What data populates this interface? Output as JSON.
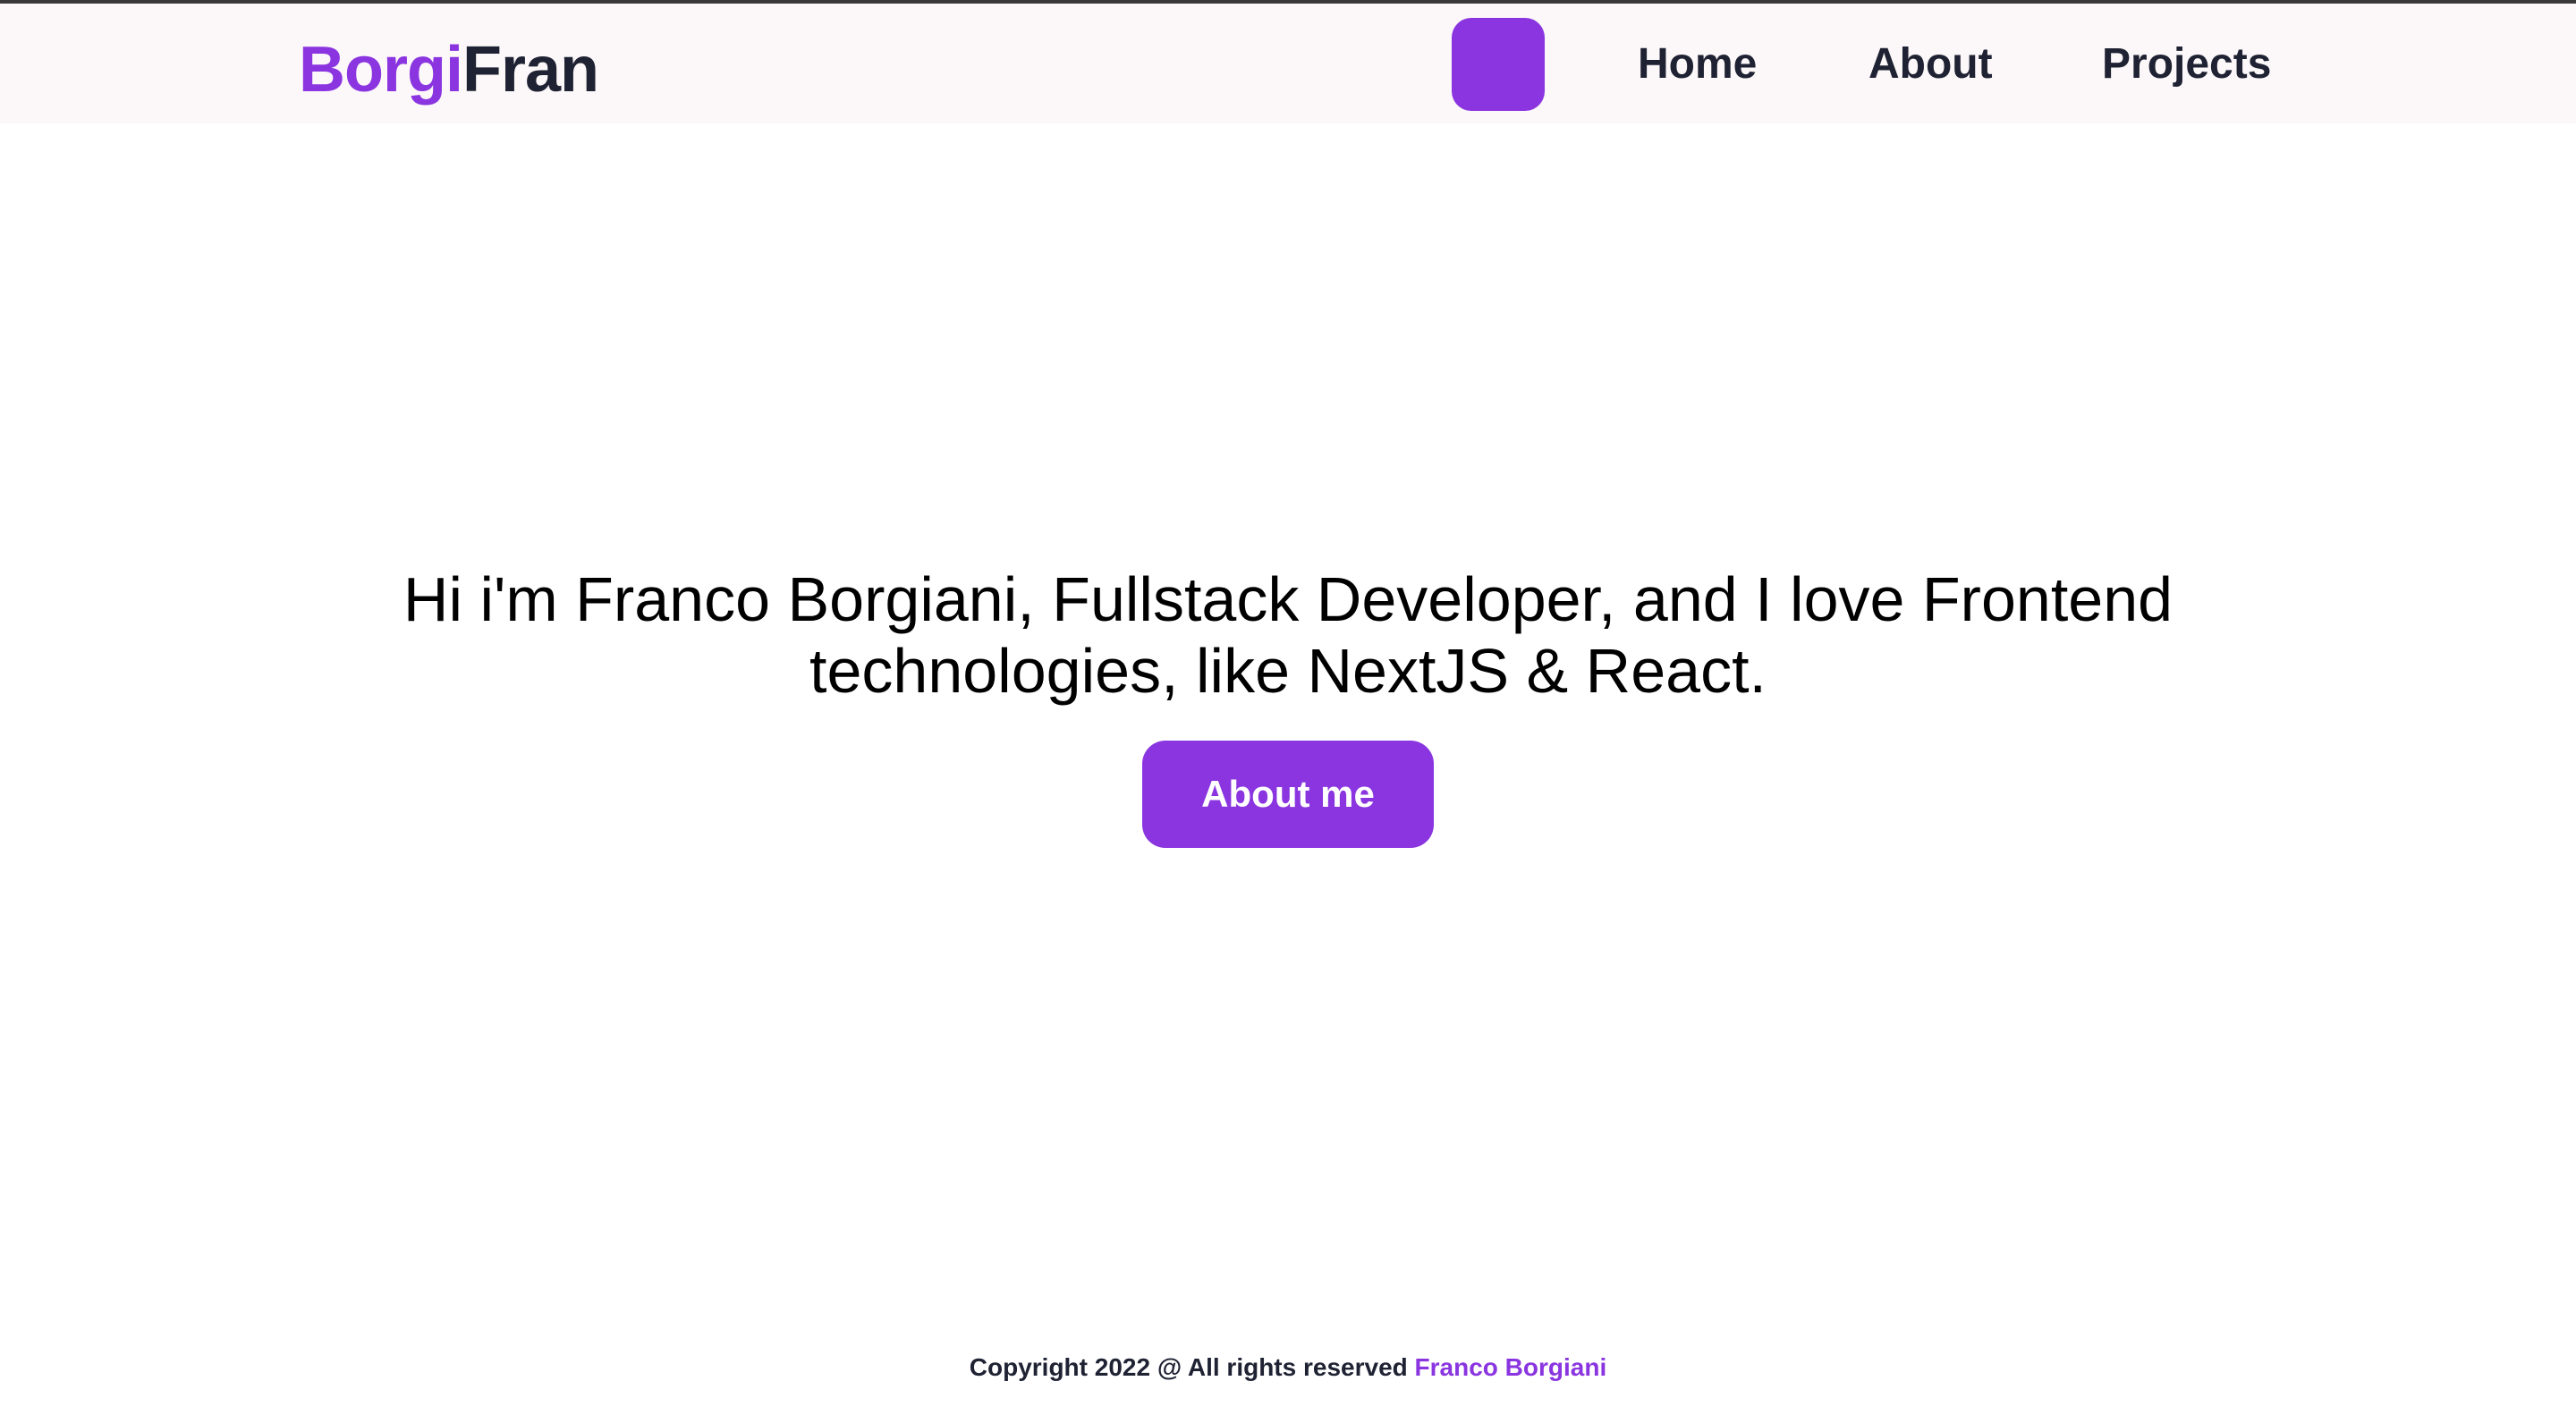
{
  "header": {
    "logo_accent": "Borgi",
    "logo_main": "Fran",
    "theme_toggle_icon": "moon-icon",
    "nav": {
      "home": "Home",
      "about": "About",
      "projects": "Projects"
    }
  },
  "hero": {
    "text": "Hi i'm Franco Borgiani, Fullstack Developer, and I love Frontend technologies, like NextJS & React.",
    "button_label": "About me"
  },
  "footer": {
    "copyright": "Copyright 2022 @ All rights reserved ",
    "author": "Franco Borgiani"
  },
  "colors": {
    "accent": "#8a35e0",
    "text_dark": "#1f2233",
    "navbar_bg": "#fcf8f9"
  }
}
